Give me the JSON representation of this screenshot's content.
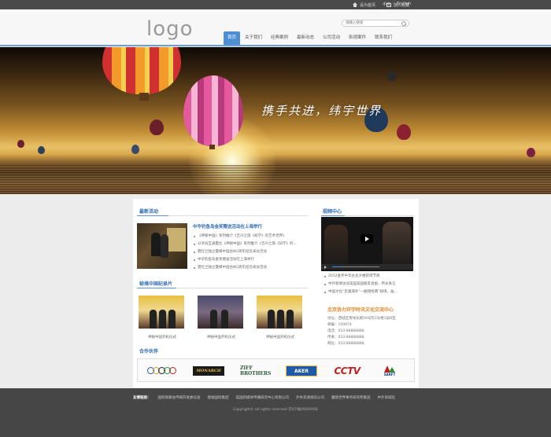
{
  "topbar": {
    "home": "设为首页",
    "favorite": "加入收藏",
    "lang_cn": "中文",
    "lang_sep": "|",
    "lang_en": "English"
  },
  "header": {
    "logo": "logo",
    "search_placeholder": "请输入搜索",
    "nav": [
      "首页",
      "关于我们",
      "经典案例",
      "最新动态",
      "公司活动",
      "影视案件",
      "联系我们"
    ]
  },
  "banner": {
    "slogan": "携手共进，纬宇世界"
  },
  "news": {
    "title": "最新活动",
    "more": "more",
    "headline": "中华钓鱼岛金奖赠送活动在上海举行",
    "items": [
      "《神秘中国》系列推介《吉兴之旅《知学》的艺术世界》",
      "分享局互通量比《神秘中国》系列推介《吉兴之旅《知学》的...",
      "樊红兰独立暨媒中国古NG周年纪念采访活动",
      "中华钓鱼岛金奖赠送活动在上海举行",
      "樊红兰独立暨媒中国古NG周年纪念采访活动"
    ]
  },
  "documentary": {
    "title": "秘境中国纪录片",
    "items": [
      {
        "caption": "神秘中国开机仪式"
      },
      {
        "caption": "神秘中国开机仪式"
      },
      {
        "caption": "神秘中国开机仪式"
      }
    ]
  },
  "partners": {
    "title": "合作伙伴",
    "logos": [
      "olympic-rings",
      "MONARCH",
      "ZIFF BROTHERS",
      "AKER",
      "CCTV",
      "SARFT"
    ]
  },
  "video": {
    "title": "视频中心",
    "items": [
      "2012金奖中华古龙大楼获得节目",
      "中外新闻访谈美国美国朋友会副，所长发言",
      "中国文化“走遍海外”一曲镜经典“秘境，画..."
    ]
  },
  "contact": {
    "org": "北京协力环宇时讯文化交流中心",
    "rows": [
      "地址：西城区南线长路59号院1号楼1层B室",
      "邮编：100874",
      "电话：010-88888888",
      "传真：010-88888888",
      "网址：010-88888888"
    ]
  },
  "footer": {
    "links_label": "友情链接：",
    "links": [
      "国际易慕会传媒开发委员会",
      "建福国际集团",
      "美国新媒体传播研究中心有限公司",
      "外失资源视讯公司",
      "魔窟世界事务研究所集团",
      "中外商城社"
    ],
    "copyright": "Copyright© all rights reserved 京ICP备000000号"
  }
}
